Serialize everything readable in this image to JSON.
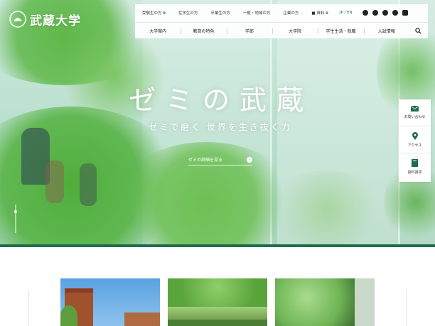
{
  "logo": {
    "text": "武蔵大学"
  },
  "header": {
    "util_links": [
      {
        "label": "受験生の方",
        "external": true
      },
      {
        "label": "在学生の方",
        "external": false
      },
      {
        "label": "卒業生の方",
        "external": false
      },
      {
        "label": "一般・地域の方",
        "external": false
      },
      {
        "label": "企業の方",
        "external": false
      },
      {
        "label": "資料",
        "external": true
      }
    ],
    "lang": "JP / EN",
    "sns": [
      "twitter-icon",
      "facebook-icon",
      "instagram-icon",
      "spotify-icon",
      "youtube-icon"
    ],
    "main_nav": [
      "大学案内",
      "教育の特色",
      "学部",
      "大学院",
      "学生生活・就職",
      "入試情報"
    ]
  },
  "hero": {
    "title": "ゼミの武蔵",
    "subtitle": "ゼミで磨く 世界を生き抜く力",
    "link_label": "ゼミの詳細を見る"
  },
  "side_links": [
    {
      "label": "お問い合わせ",
      "icon": "mail-icon"
    },
    {
      "label": "アクセス",
      "icon": "map-pin-icon"
    },
    {
      "label": "資料請求",
      "icon": "brochure-icon"
    }
  ],
  "colors": {
    "brand": "#1f6e4a"
  }
}
